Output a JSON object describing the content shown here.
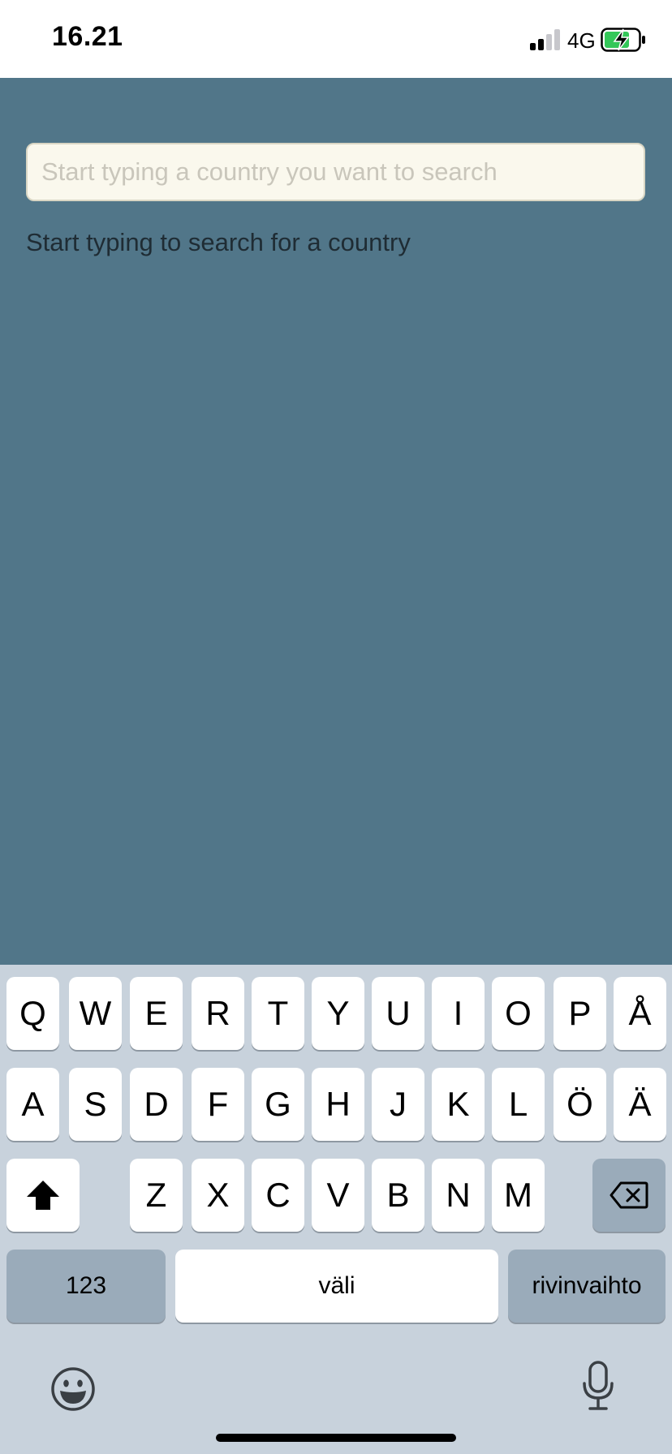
{
  "status_bar": {
    "time": "16.21",
    "network": "4G",
    "signal_bars_filled": 2,
    "signal_bars_total": 4,
    "battery_charging": true,
    "battery_color": "#34c759"
  },
  "search": {
    "placeholder": "Start typing a country you want to search",
    "value": ""
  },
  "hint": "Start typing to search for a country",
  "colors": {
    "background": "#517689",
    "input_background": "#faf8ed",
    "keyboard_background": "#c8d2dc"
  },
  "keyboard": {
    "row1": [
      "Q",
      "W",
      "E",
      "R",
      "T",
      "Y",
      "U",
      "I",
      "O",
      "P",
      "Å"
    ],
    "row2": [
      "A",
      "S",
      "D",
      "F",
      "G",
      "H",
      "J",
      "K",
      "L",
      "Ö",
      "Ä"
    ],
    "row3": [
      "Z",
      "X",
      "C",
      "V",
      "B",
      "N",
      "M"
    ],
    "numbers_label": "123",
    "space_label": "väli",
    "return_label": "rivinvaihto",
    "shift_icon": "shift-icon",
    "delete_icon": "delete-icon",
    "emoji_icon": "emoji-icon",
    "mic_icon": "microphone-icon"
  }
}
